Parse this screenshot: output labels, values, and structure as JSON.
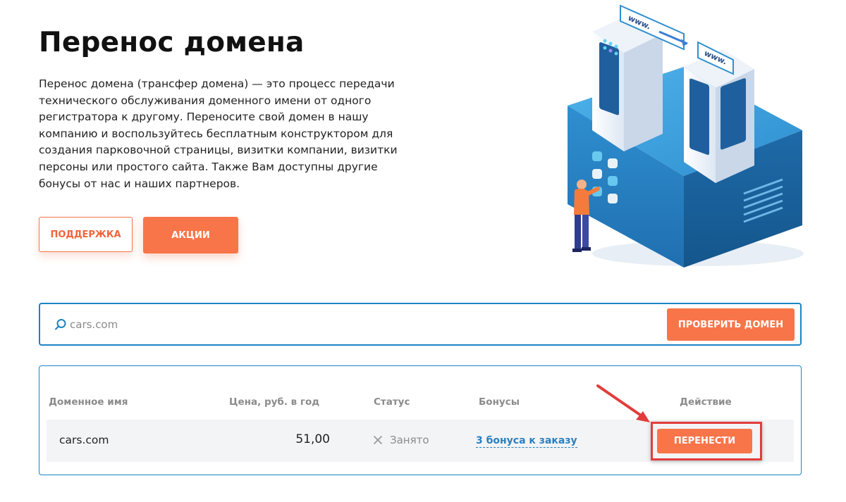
{
  "page": {
    "title": "Перенос домена",
    "intro": "Перенос домена (трансфер домена) — это процесс передачи технического обслуживания доменного имени от одного регистратора к другому. Переносите свой домен в нашу компанию и воспользуйтесь бесплатным конструктором для создания парковочной страницы, визитки компании, визитки персоны или простого сайта. Также Вам доступны другие бонусы от нас и наших партнеров."
  },
  "buttons": {
    "support": "ПОДДЕРЖКА",
    "promotions": "АКЦИИ"
  },
  "illustration": {
    "label_left": "www.",
    "label_right": "www."
  },
  "search": {
    "value": "cars.com",
    "check_label": "ПРОВЕРИТЬ ДОМЕН",
    "icon": "search-icon"
  },
  "results": {
    "columns": {
      "domain": "Доменное имя",
      "price": "Цена, руб. в год",
      "status": "Статус",
      "bonuses": "Бонусы",
      "action": "Действие"
    },
    "row": {
      "domain": "cars.com",
      "price": "51,00",
      "status": "Занято",
      "status_icon": "close-icon",
      "bonus": "3 бонуса к заказу",
      "action_label": "ПЕРЕНЕСТИ"
    }
  },
  "colors": {
    "accent": "#f87549",
    "border_blue": "#1b84c4",
    "link_blue": "#2a7fbf",
    "highlight_red": "#e23c3c"
  }
}
